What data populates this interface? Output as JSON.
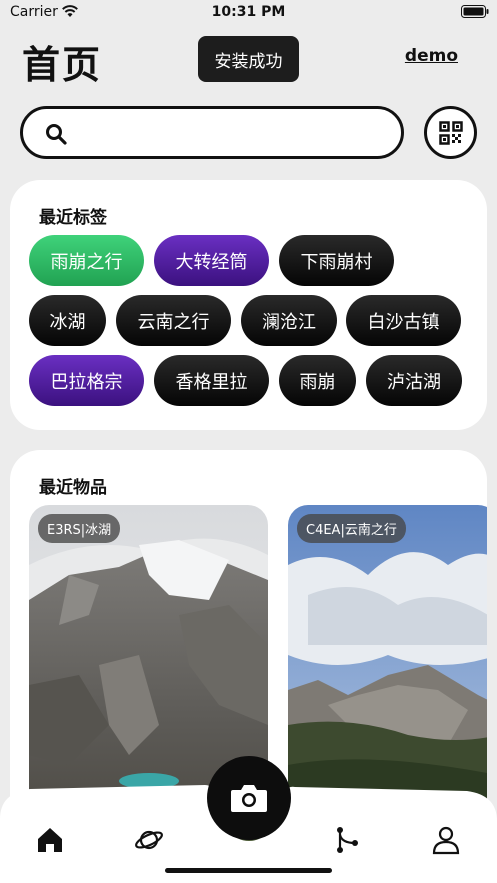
{
  "status_bar": {
    "carrier": "Carrier",
    "time": "10:31 PM"
  },
  "header": {
    "title": "首页",
    "toast": "安装成功",
    "user": "demo"
  },
  "search": {
    "value": "",
    "placeholder": ""
  },
  "recent_tags": {
    "title": "最近标签",
    "tags": [
      "雨崩之行",
      "大转经筒",
      "下雨崩村",
      "冰湖",
      "云南之行",
      "澜沧江",
      "白沙古镇",
      "巴拉格宗",
      "香格里拉",
      "雨崩",
      "泸沽湖"
    ],
    "colors": {
      "green": "#2cbf63",
      "purple": "#4f1ca3",
      "black": "#111111"
    }
  },
  "recent_items": {
    "title": "最近物品",
    "items": [
      {
        "label": "E3RS|冰湖"
      },
      {
        "label": "C4EA|云南之行"
      }
    ]
  },
  "nav": {
    "items": [
      "home-icon",
      "planet-icon",
      "camera-icon",
      "branch-icon",
      "user-icon"
    ]
  }
}
